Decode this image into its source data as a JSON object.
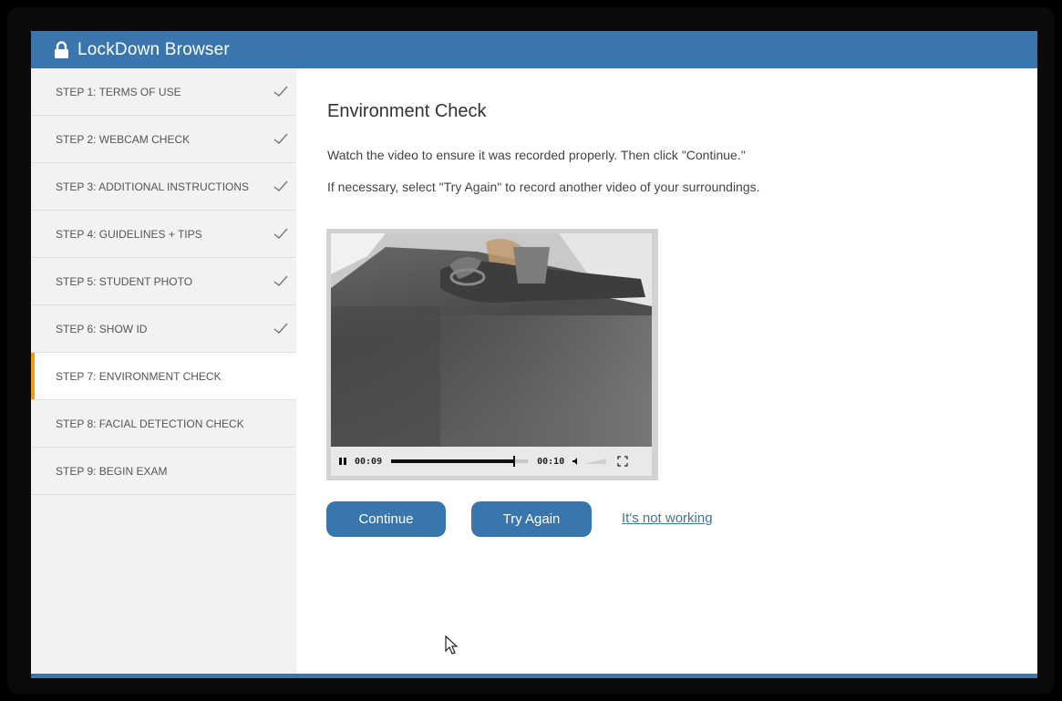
{
  "app": {
    "title": "LockDown Browser"
  },
  "sidebar": {
    "steps": [
      {
        "label": "STEP 1: TERMS OF USE",
        "completed": true
      },
      {
        "label": "STEP 2: WEBCAM CHECK",
        "completed": true
      },
      {
        "label": "STEP 3: ADDITIONAL INSTRUCTIONS",
        "completed": true
      },
      {
        "label": "STEP 4: GUIDELINES + TIPS",
        "completed": true
      },
      {
        "label": "STEP 5: STUDENT PHOTO",
        "completed": true
      },
      {
        "label": "STEP 6: SHOW ID",
        "completed": true
      },
      {
        "label": "STEP 7: ENVIRONMENT CHECK",
        "completed": false,
        "active": true
      },
      {
        "label": "STEP 8: FACIAL DETECTION CHECK",
        "completed": false
      },
      {
        "label": "STEP 9: BEGIN EXAM",
        "completed": false
      }
    ]
  },
  "main": {
    "heading": "Environment Check",
    "instruction_1": "Watch the video to ensure it was recorded properly. Then click \"Continue.\"",
    "instruction_2": "If necessary, select \"Try Again\" to record another video of your surroundings.",
    "video": {
      "current_time": "00:09",
      "total_time": "00:10",
      "progress": 0.9,
      "state": "playing"
    },
    "continue_label": "Continue",
    "try_again_label": "Try Again",
    "not_working_label": "It's not working"
  },
  "colors": {
    "brand_blue": "#3876ad",
    "active_accent": "#f39a1e",
    "sidebar_bg": "#f2f2f2"
  },
  "icons": {
    "title": "lock-icon",
    "completed_step": "check-icon",
    "video_play_state": "pause-icon",
    "volume": "volume-icon",
    "fullscreen": "fullscreen-icon",
    "pointer": "mouse-cursor-icon"
  }
}
